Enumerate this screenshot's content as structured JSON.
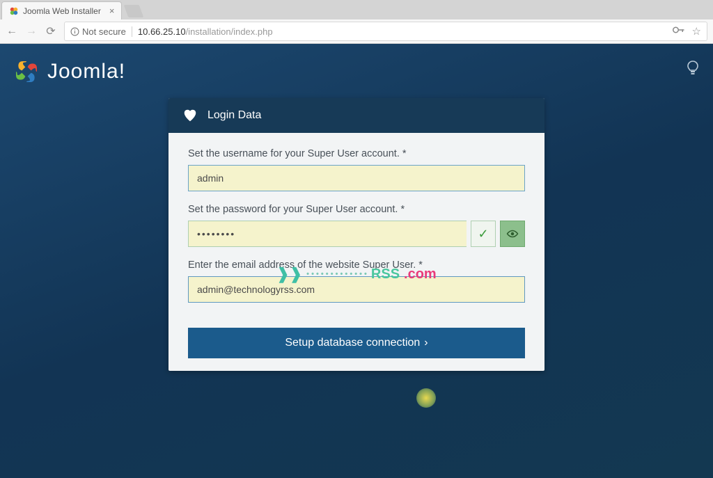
{
  "browser": {
    "tab_title": "Joomla Web Installer",
    "security_status": "Not secure",
    "url_host": "10.66.25.10",
    "url_path": "/installation/index.php"
  },
  "logo": {
    "brand": "Joomla!"
  },
  "card": {
    "header_title": "Login Data",
    "username_label": "Set the username for your Super User account. *",
    "username_value": "admin",
    "password_label": "Set the password for your Super User account. *",
    "password_value": "••••••••",
    "email_label": "Enter the email address of the website Super User. *",
    "email_value": "admin@technologyrss.com",
    "submit_label": "Setup database connection"
  },
  "watermark": {
    "rss": "RSS",
    "com": ".com"
  }
}
